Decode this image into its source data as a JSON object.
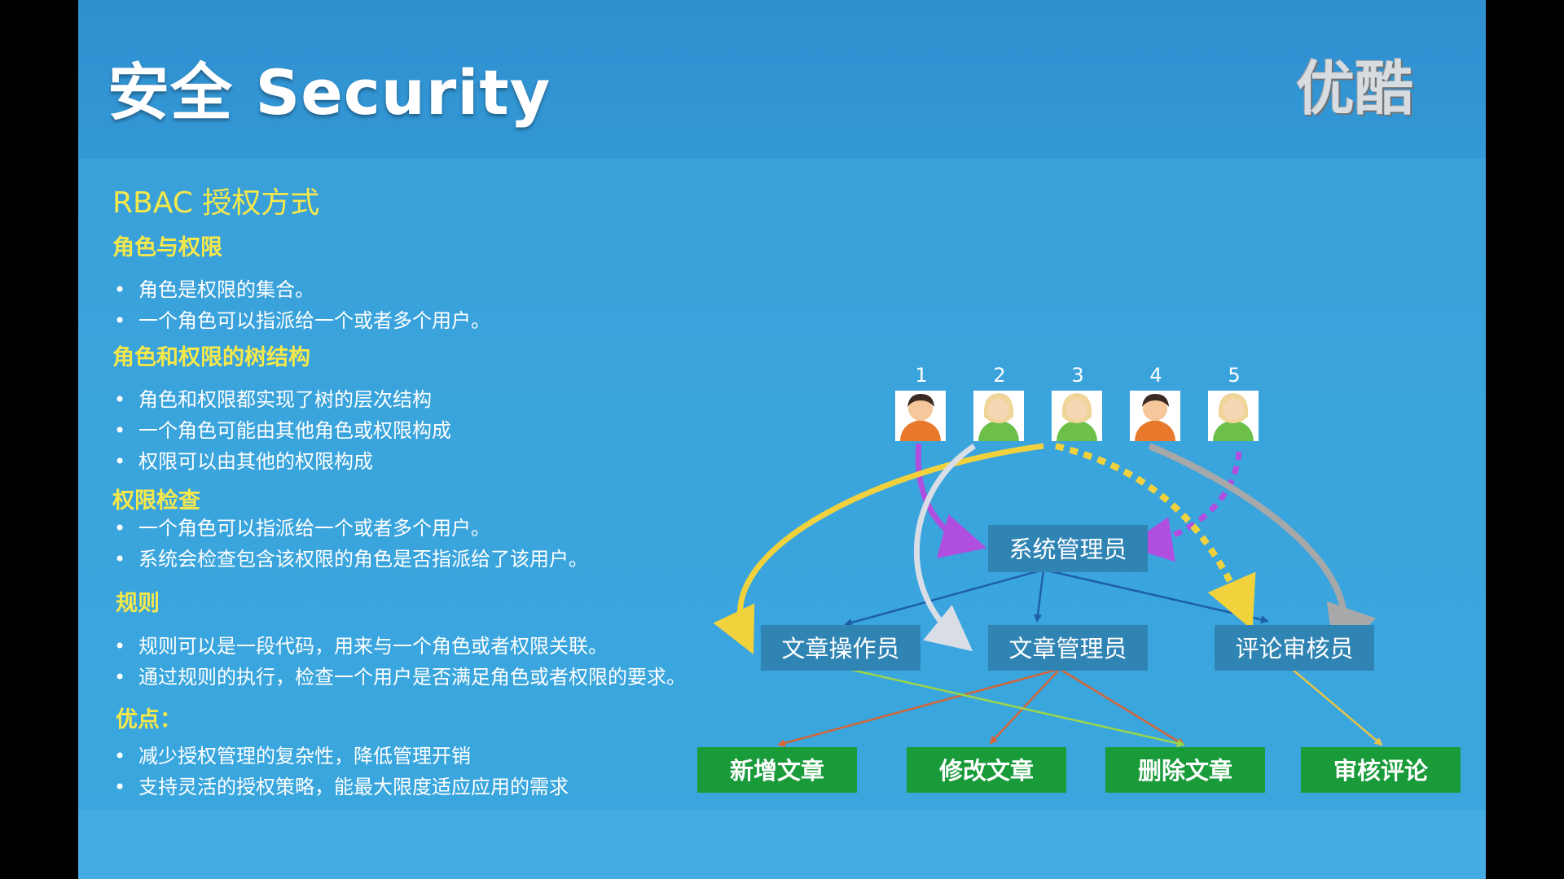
{
  "slide": {
    "title": "安全 Security",
    "brand": "优酷"
  },
  "content": {
    "main_heading": "RBAC 授权方式",
    "sections": [
      {
        "heading": "角色与权限",
        "bullets": [
          "角色是权限的集合。",
          "一个角色可以指派给一个或者多个用户。"
        ]
      },
      {
        "heading": "角色和权限的树结构",
        "bullets": [
          "角色和权限都实现了树的层次结构",
          "一个角色可能由其他角色或权限构成",
          "权限可以由其他的权限构成"
        ]
      },
      {
        "heading": "权限检查",
        "bullets": [
          "一个角色可以指派给一个或者多个用户。",
          "系统会检查包含该权限的角色是否指派给了该用户。"
        ]
      },
      {
        "heading": "规则",
        "bullets": [
          "规则可以是一段代码，用来与一个角色或者权限关联。",
          "通过规则的执行，检查一个用户是否满足角色或者权限的要求。"
        ]
      },
      {
        "heading": "优点：",
        "bullets": [
          "减少授权管理的复杂性，降低管理开销",
          "支持灵活的授权策略，能最大限度适应应用的需求"
        ]
      }
    ],
    "bullet_char": "•"
  },
  "diagram": {
    "users": [
      {
        "number": "1",
        "avatar": "male-user-icon"
      },
      {
        "number": "2",
        "avatar": "female-user-icon"
      },
      {
        "number": "3",
        "avatar": "female-user-icon"
      },
      {
        "number": "4",
        "avatar": "male-user-icon"
      },
      {
        "number": "5",
        "avatar": "female-user-icon"
      }
    ],
    "roles": {
      "admin": "系统管理员",
      "article_operator": "文章操作员",
      "article_manager": "文章管理员",
      "comment_reviewer": "评论审核员"
    },
    "permissions": {
      "add_article": "新增文章",
      "edit_article": "修改文章",
      "delete_article": "删除文章",
      "review_comment": "审核评论"
    },
    "colors": {
      "role_box": "#2f84b4",
      "permission_box": "#1a9b3a",
      "arrow_purple": "#b04ee0",
      "arrow_yellow": "#f2d23c",
      "arrow_white": "#d9dde6",
      "arrow_gray": "#a6a8aa",
      "link_blue": "#1e5fa8",
      "link_orange": "#d2663a",
      "link_green": "#9bd64a",
      "link_gold": "#e8c347"
    }
  }
}
